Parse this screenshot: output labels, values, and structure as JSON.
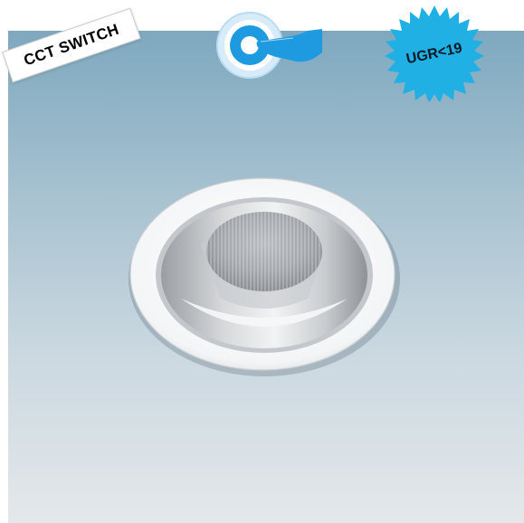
{
  "badges": {
    "cct_switch": "CCT SWITCH",
    "ugr": "UGR<19"
  },
  "icons": {
    "switch": "hand-pressing-button-icon"
  },
  "colors": {
    "background_top": "#7ea8bf",
    "background_bottom": "#e4e8eb",
    "ugr_badge": "#20b0e4",
    "switch_blue": "#1e9be0"
  }
}
